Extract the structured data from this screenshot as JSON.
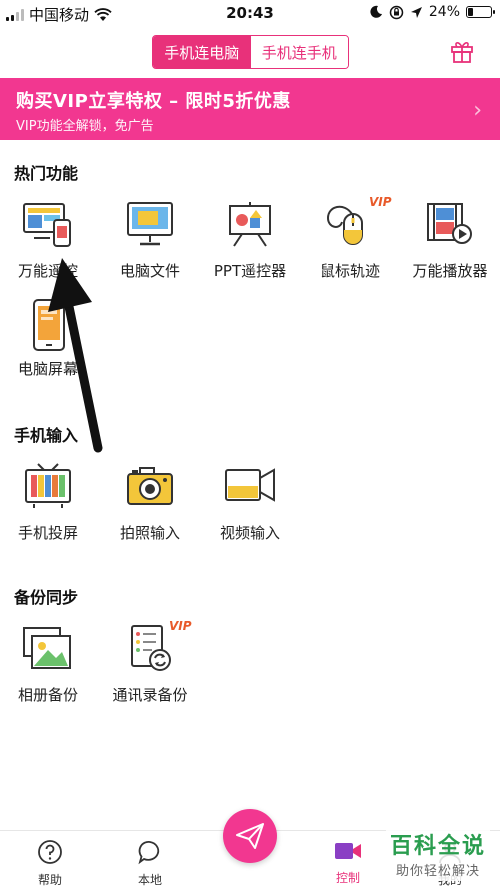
{
  "status_bar": {
    "carrier": "中国移动",
    "time": "20:43",
    "battery": "24%",
    "battery_level": 0.24
  },
  "header": {
    "tabs": [
      {
        "label": "手机连电脑",
        "active": true
      },
      {
        "label": "手机连手机",
        "active": false
      }
    ]
  },
  "banner": {
    "title": "购买VIP立享特权 – 限时5折优惠",
    "subtitle": "VIP功能全解锁，免广告"
  },
  "sections": [
    {
      "title": "热门功能",
      "items": [
        {
          "label": "万能遥控",
          "icon": "remote-icon"
        },
        {
          "label": "电脑文件",
          "icon": "monitor-icon"
        },
        {
          "label": "PPT遥控器",
          "icon": "ppt-icon"
        },
        {
          "label": "鼠标轨迹",
          "icon": "mouse-icon",
          "badge": "VIP"
        },
        {
          "label": "万能播放器",
          "icon": "player-icon"
        },
        {
          "label": "电脑屏幕",
          "icon": "phone-screen-icon"
        }
      ]
    },
    {
      "title": "手机输入",
      "items": [
        {
          "label": "手机投屏",
          "icon": "tv-icon"
        },
        {
          "label": "拍照输入",
          "icon": "camera-icon"
        },
        {
          "label": "视频输入",
          "icon": "video-icon"
        }
      ]
    },
    {
      "title": "备份同步",
      "items": [
        {
          "label": "相册备份",
          "icon": "album-icon"
        },
        {
          "label": "通讯录备份",
          "icon": "contacts-icon",
          "badge": "VIP"
        }
      ]
    }
  ],
  "bottom_nav": [
    {
      "label": "帮助",
      "icon": "help-icon"
    },
    {
      "label": "本地",
      "icon": "chat-icon"
    },
    {
      "label": "控制",
      "icon": "control-icon",
      "active": true
    },
    {
      "label": "我的",
      "icon": "user-icon"
    }
  ],
  "watermark": {
    "line1": "百科全说",
    "line2": "助你轻松解决"
  },
  "colors": {
    "accent": "#e8317a",
    "banner": "#f23790",
    "watermark": "#2a9d4f"
  }
}
